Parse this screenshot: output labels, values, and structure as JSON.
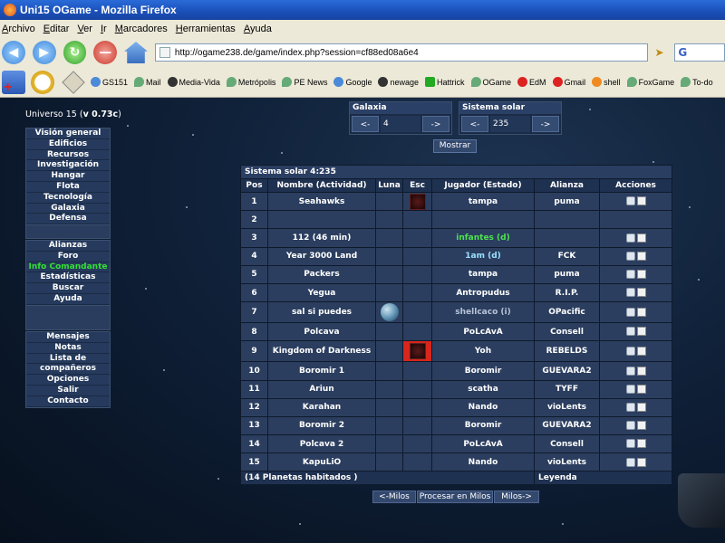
{
  "window": {
    "title": "Uni15 OGame - Mozilla Firefox"
  },
  "menubar": [
    "Archivo",
    "Editar",
    "Ver",
    "Ir",
    "Marcadores",
    "Herramientas",
    "Ayuda"
  ],
  "urlbar": {
    "url": "http://ogame238.de/game/index.php?session=cf88ed08a6e4",
    "search_text": "G"
  },
  "bookmarks": [
    {
      "label": "GS151",
      "icon": "g"
    },
    {
      "label": "Mail",
      "icon": "pin"
    },
    {
      "label": "Media-Vida",
      "icon": "dark"
    },
    {
      "label": "Metrópolis",
      "icon": "pin"
    },
    {
      "label": "PE News",
      "icon": "pin"
    },
    {
      "label": "Google",
      "icon": "g"
    },
    {
      "label": "newage",
      "icon": "dark"
    },
    {
      "label": "Hattrick",
      "icon": "green"
    },
    {
      "label": "OGame",
      "icon": "pin"
    },
    {
      "label": "EdM",
      "icon": "red"
    },
    {
      "label": "Gmail",
      "icon": "red"
    },
    {
      "label": "shell",
      "icon": "orange"
    },
    {
      "label": "FoxGame",
      "icon": "pin"
    },
    {
      "label": "To-do",
      "icon": "pin"
    }
  ],
  "universe": {
    "label": "Universo 15 (",
    "version": "v 0.73c",
    "close": ")"
  },
  "left_menu": {
    "group1": [
      "Visión general",
      "Edificios",
      "Recursos",
      "Investigación",
      "Hangar",
      "Flota",
      "Tecnología",
      "Galaxia",
      "Defensa"
    ],
    "group2": [
      "Alianzas",
      "Foro",
      "Info Comandante",
      "Estadísticas",
      "Buscar",
      "Ayuda"
    ],
    "group3": [
      "Mensajes",
      "Notas",
      "Lista de",
      "compañeros",
      "Opciones",
      "Salir",
      "Contacto"
    ]
  },
  "selector": {
    "galaxy_label": "Galaxia",
    "galaxy_value": "4",
    "system_label": "Sistema solar",
    "system_value": "235",
    "prev": "<-",
    "next": "->",
    "show_button": "Mostrar"
  },
  "table": {
    "title": "Sistema solar 4:235",
    "headers": [
      "Pos",
      "Nombre (Actividad)",
      "Luna",
      "Esc",
      "Jugador (Estado)",
      "Alianza",
      "Acciones"
    ],
    "rows": [
      {
        "pos": "1",
        "name": "Seahawks",
        "player": "tampa",
        "alliance": "puma"
      },
      {
        "pos": "2",
        "name": "",
        "player": "",
        "alliance": ""
      },
      {
        "pos": "3",
        "name": "112 (46 min)",
        "player": "infantes (d)",
        "alliance": ""
      },
      {
        "pos": "4",
        "name": "Year 3000 Land",
        "player": "1am (d)",
        "alliance": "FCK"
      },
      {
        "pos": "5",
        "name": "Packers",
        "player": "tampa",
        "alliance": "puma"
      },
      {
        "pos": "6",
        "name": "Yegua",
        "player": "Antropudus",
        "alliance": "R.I.P."
      },
      {
        "pos": "7",
        "name": "sal si puedes",
        "player": "shellcaco (i)",
        "alliance": "OPacific"
      },
      {
        "pos": "8",
        "name": "Polcava",
        "player": "PoLcAvA",
        "alliance": "Consell"
      },
      {
        "pos": "9",
        "name": "Kingdom of Darkness",
        "player": "Yoh",
        "alliance": "REBELDS"
      },
      {
        "pos": "10",
        "name": "Boromir 1",
        "player": "Boromir",
        "alliance": "GUEVARA2"
      },
      {
        "pos": "11",
        "name": "Ariun",
        "player": "scatha",
        "alliance": "TYFF"
      },
      {
        "pos": "12",
        "name": "Karahan",
        "player": "Nando",
        "alliance": "vioLents"
      },
      {
        "pos": "13",
        "name": "Boromir 2",
        "player": "Boromir",
        "alliance": "GUEVARA2"
      },
      {
        "pos": "14",
        "name": "Polcava 2",
        "player": "PoLcAvA",
        "alliance": "Consell"
      },
      {
        "pos": "15",
        "name": "KapuLiO",
        "player": "Nando",
        "alliance": "vioLents"
      }
    ],
    "footer_count": "(14 Planetas habitados )",
    "footer_legend": "Leyenda"
  },
  "pager": {
    "prev": "<-Milos",
    "process": "Procesar en Milos",
    "next": "Milos->"
  },
  "colors": {
    "active_menu": "#33e033",
    "inactive_player": "#4ee24e",
    "table_bg": "#2b3e5f"
  }
}
